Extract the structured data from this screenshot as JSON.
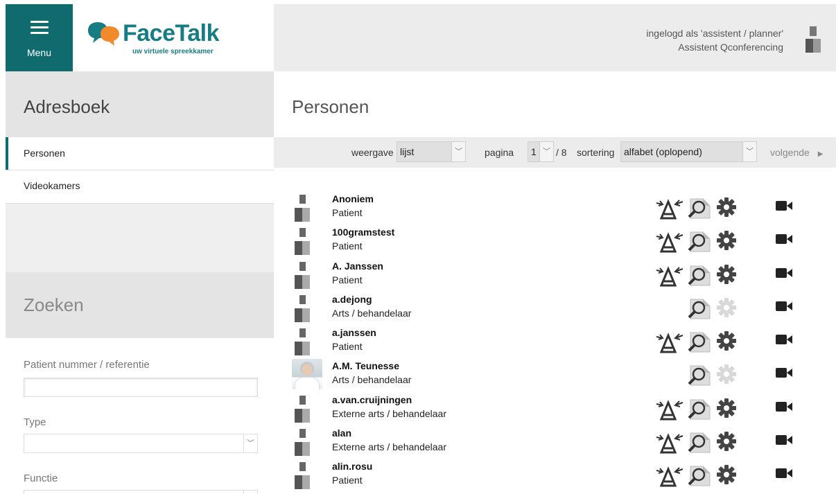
{
  "header": {
    "menu_label": "Menu",
    "logo_text": "FaceTalk",
    "logo_sub": "uw virtuele spreekkamer",
    "user_line1": "ingelogd als 'assistent / planner'",
    "user_line2": "Assistent Qconferencing"
  },
  "sidebar": {
    "title": "Adresboek",
    "items": [
      {
        "label": "Personen",
        "active": true
      },
      {
        "label": "Videokamers",
        "active": false
      }
    ],
    "search_title": "Zoeken",
    "fields": {
      "patient_label": "Patient nummer / referentie",
      "patient_value": "",
      "type_label": "Type",
      "type_value": "",
      "functie_label": "Functie",
      "functie_value": ""
    }
  },
  "main": {
    "title": "Personen",
    "toolbar": {
      "view_label": "weergave",
      "view_value": "lijst",
      "page_label": "pagina",
      "page_value": "1",
      "page_total": "/ 8",
      "sort_label": "sortering",
      "sort_value": "alfabet (oplopend)",
      "next_label": "volgende"
    },
    "persons": [
      {
        "name": "Anoniem",
        "role": "Patient",
        "assign": true,
        "gear_enabled": true,
        "photo": false
      },
      {
        "name": "100gramstest",
        "role": "Patient",
        "assign": true,
        "gear_enabled": true,
        "photo": false
      },
      {
        "name": "A. Janssen",
        "role": "Patient",
        "assign": true,
        "gear_enabled": true,
        "photo": false
      },
      {
        "name": "a.dejong",
        "role": "Arts / behandelaar",
        "assign": false,
        "gear_enabled": false,
        "photo": false
      },
      {
        "name": "a.janssen",
        "role": "Patient",
        "assign": true,
        "gear_enabled": true,
        "photo": false
      },
      {
        "name": "A.M. Teunesse",
        "role": "Arts / behandelaar",
        "assign": false,
        "gear_enabled": false,
        "photo": true
      },
      {
        "name": "a.van.cruijningen",
        "role": "Externe arts / behandelaar",
        "assign": true,
        "gear_enabled": true,
        "photo": false
      },
      {
        "name": "alan",
        "role": "Externe arts / behandelaar",
        "assign": true,
        "gear_enabled": true,
        "photo": false
      },
      {
        "name": "alin.rosu",
        "role": "Patient",
        "assign": true,
        "gear_enabled": true,
        "photo": false
      }
    ]
  },
  "colors": {
    "brand": "#0f6b6e",
    "logo": "#177d84",
    "logo_bubble_orange": "#f08a2a",
    "icon_gray": "#444444",
    "icon_disabled": "#d8d8d8"
  },
  "icons": [
    "hamburger-icon",
    "user-silhouette-icon",
    "assign-icon",
    "magnifier-icon",
    "gear-icon",
    "video-camera-icon",
    "chevron-down-icon",
    "chevron-right-icon"
  ]
}
